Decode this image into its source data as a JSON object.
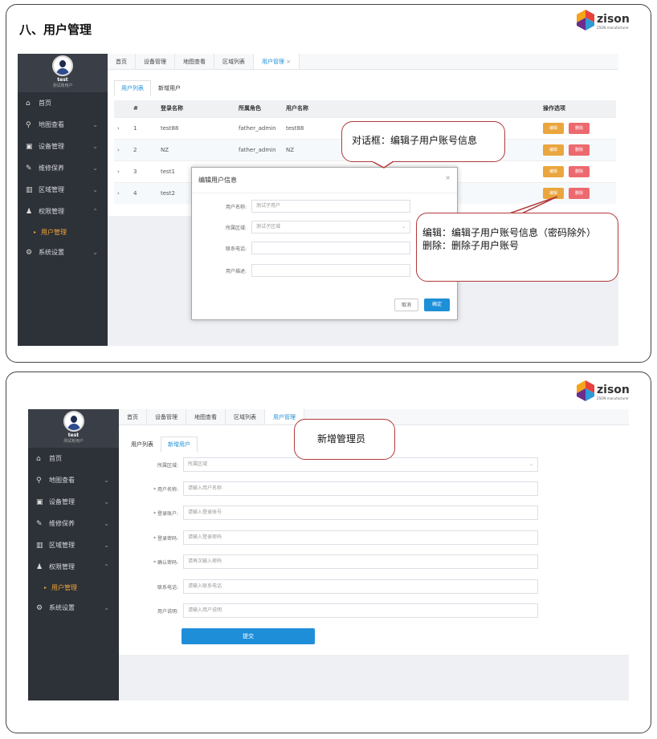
{
  "section_title": "八、用户管理",
  "logo": {
    "text": "zison",
    "tagline": "ZSON manufacturer"
  },
  "sidebar": {
    "user_name": "test",
    "user_role": "测试账用户",
    "items": [
      {
        "label": "首页",
        "icon": "home-icon",
        "glyph": "⌂"
      },
      {
        "label": "地图查看",
        "icon": "map-icon",
        "glyph": "⚲"
      },
      {
        "label": "设备管理",
        "icon": "device-icon",
        "glyph": "▣"
      },
      {
        "label": "维修保养",
        "icon": "wrench-icon",
        "glyph": "✎"
      },
      {
        "label": "区域管理",
        "icon": "area-icon",
        "glyph": "▥"
      },
      {
        "label": "权限管理",
        "icon": "user-group-icon",
        "glyph": "♟"
      },
      {
        "label": "用户管理",
        "icon": "sub-item",
        "glyph": "▸"
      },
      {
        "label": "系统设置",
        "icon": "gear-icon",
        "glyph": "⚙"
      }
    ],
    "items2": [
      {
        "label": "首页"
      },
      {
        "label": "地图查看"
      },
      {
        "label": "设备管理"
      },
      {
        "label": "维修保养"
      },
      {
        "label": "区域管理"
      },
      {
        "label": "权限管理"
      },
      {
        "label": "用户管理"
      },
      {
        "label": "系统设置"
      }
    ]
  },
  "tabs": [
    "首页",
    "设备管理",
    "地图查看",
    "区域列表",
    "用户管理"
  ],
  "tab_close": "×",
  "subtabs": [
    "用户列表",
    "新增用户"
  ],
  "table": {
    "headers": [
      "#",
      "登录名称",
      "所属角色",
      "用户名称",
      "操作选项"
    ],
    "rows": [
      {
        "idx": "1",
        "login": "test88",
        "role": "father_admin",
        "name": "test88"
      },
      {
        "idx": "2",
        "login": "NZ",
        "role": "father_admin",
        "name": "NZ"
      },
      {
        "idx": "3",
        "login": "test1",
        "role": "",
        "name": ""
      },
      {
        "idx": "4",
        "login": "test2",
        "role": "",
        "name": ""
      }
    ],
    "edit_label": "编辑",
    "delete_label": "删除",
    "expand": "›"
  },
  "modal": {
    "title": "编辑用户信息",
    "close": "×",
    "fields": [
      {
        "label": "用户名称:",
        "value": "测试子用户"
      },
      {
        "label": "所属区域:",
        "value": "测试子区域"
      },
      {
        "label": "联系电话:",
        "value": ""
      },
      {
        "label": "用户描述:",
        "value": ""
      }
    ],
    "cancel": "取消",
    "confirm": "确定"
  },
  "callouts": {
    "dialog": "对话框：编辑子用户账号信息",
    "edit_line1": "编辑：编辑子用户账号信息（密码除外）",
    "edit_line2": "删除：删除子用户账号",
    "add": "新增管理员"
  },
  "add_form": {
    "fields": [
      {
        "label": "所属区域:",
        "placeholder": "所属区域",
        "select": true
      },
      {
        "label": "* 用户名称:",
        "placeholder": "请输入用户名称"
      },
      {
        "label": "* 登录账户:",
        "placeholder": "请输入登录账号"
      },
      {
        "label": "* 登录密码:",
        "placeholder": "请输入登录密码"
      },
      {
        "label": "* 确认密码:",
        "placeholder": "请再次输入密码"
      },
      {
        "label": "联系电话:",
        "placeholder": "请输入联系电话"
      },
      {
        "label": "用户说明:",
        "placeholder": "请输入用户说明"
      }
    ],
    "submit": "提交"
  },
  "colors": {
    "accent": "#1e90d8",
    "edit": "#eaa63e",
    "delete": "#ec6a6f",
    "sidebar": "#2d3138",
    "callout_border": "#b13a3a"
  }
}
